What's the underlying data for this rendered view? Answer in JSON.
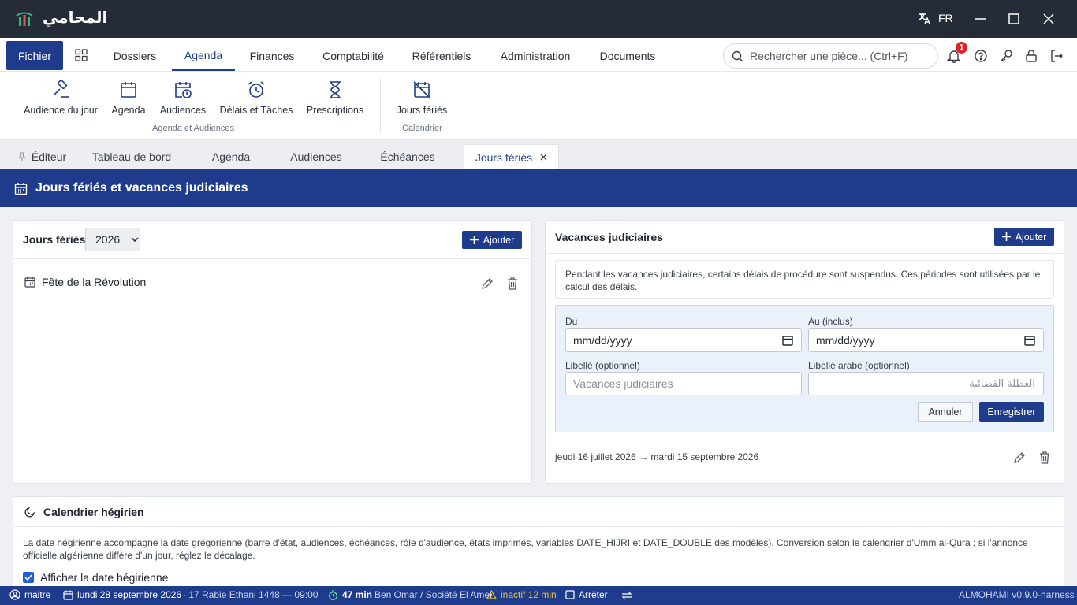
{
  "app": {
    "title": "المحامي",
    "lang": "FR"
  },
  "menu": {
    "fichier": "Fichier",
    "items": [
      "Dossiers",
      "Agenda",
      "Finances",
      "Comptabilité",
      "Référentiels",
      "Administration",
      "Documents"
    ],
    "active": "Agenda",
    "search_placeholder": "Rechercher une pièce... (Ctrl+F)",
    "notification_count": "1"
  },
  "ribbon": {
    "buttons": [
      "Audience du jour",
      "Agenda",
      "Audiences",
      "Délais et Tâches",
      "Prescriptions",
      "Jours fériés"
    ],
    "groups": [
      "Agenda et Audiences",
      "Calendrier"
    ]
  },
  "tabs": {
    "items": [
      "Éditeur",
      "Tableau de bord",
      "Agenda",
      "Audiences",
      "Échéances",
      "Jours fériés"
    ],
    "active": "Jours fériés"
  },
  "page": {
    "title": "Jours fériés et vacances judiciaires"
  },
  "holidays": {
    "title": "Jours fériés",
    "year": "2026",
    "add_label": "Ajouter",
    "items": [
      "Fête de la Révolution"
    ]
  },
  "vacances": {
    "title": "Vacances judiciaires",
    "add_label": "Ajouter",
    "info": "Pendant les vacances judiciaires, certains délais de procédure sont suspendus. Ces périodes sont utilisées par le calcul des délais.",
    "form": {
      "du_label": "Du",
      "au_label": "Au (inclus)",
      "du_value": "mm/dd/yyyy",
      "au_value": "mm/dd/yyyy",
      "libelle_label": "Libellé (optionnel)",
      "libelle_placeholder": "Vacances judiciaires",
      "libelle_ar_label": "Libellé arabe (optionnel)",
      "libelle_ar_placeholder": "العطلة القضائية",
      "cancel": "Annuler",
      "save": "Enregistrer"
    },
    "period": "jeudi 16 juillet 2026 → mardi 15 septembre 2026"
  },
  "hijri": {
    "title": "Calendrier hégirien",
    "description": "La date hégirienne accompagne la date grégorienne (barre d'état, audiences, échéances, rôle d'audience, états imprimés, variables DATE_HIJRI et DATE_DOUBLE des modèles). Conversion selon le calendrier d'Umm al-Qura ; si l'annonce officielle algérienne diffère d'un jour, réglez le décalage.",
    "checkbox_label": "Afficher la date hégirienne",
    "checked": true
  },
  "status": {
    "user": "maitre",
    "date": "lundi 28 septembre 2026",
    "hijri_time": "· 17 Rabie Ethani 1448 — 09:00",
    "timer": "47 min",
    "client": "Ben Omar / Société El Amel",
    "inactive": "inactif 12 min",
    "stop": "Arrêter",
    "version": "ALMOHAMI v0.9.0-harness"
  },
  "colors": {
    "primary": "#1f3b8c",
    "titlebar": "#252b37",
    "badge": "#d9262c",
    "warning": "#f2c230"
  }
}
